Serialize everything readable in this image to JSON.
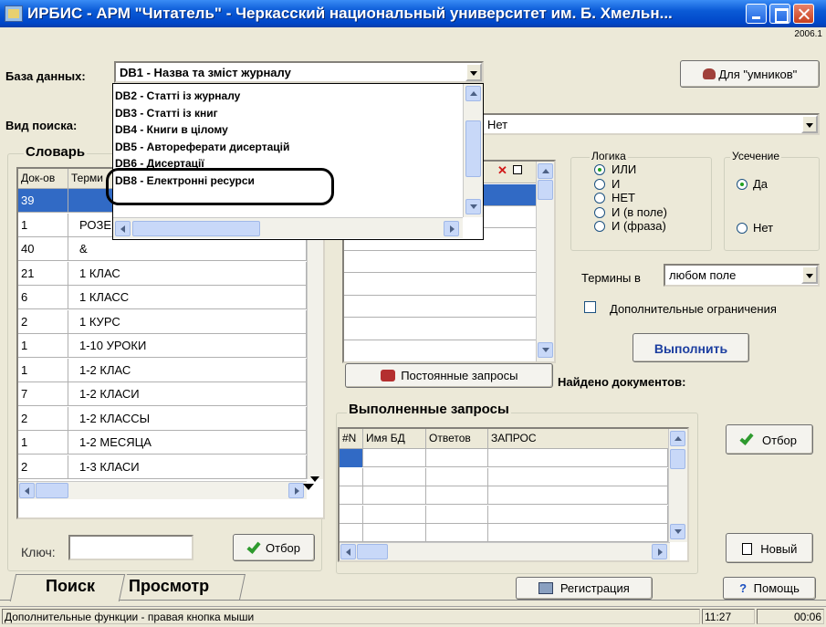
{
  "window": {
    "title": "ИРБИС - АРМ \"Читатель\" - Черкасский национальный университет им. Б. Хмельн...",
    "version": "2006.1"
  },
  "header": {
    "database_label": "База данных:",
    "database_value": "DB1 - Назва та зміст журналу",
    "smart_button": "Для \"умников\"",
    "search_type_label": "Вид поиска:",
    "search_type_value": "Нет"
  },
  "dropdown": {
    "items": [
      "DB2 - Статті із журналу",
      "DB3 - Статті із книг",
      "DB4 - Книги в цілому",
      "DB5 - Автореферати дисертацій",
      "DB6 - Дисертації",
      "DB8 - Електронні ресурси"
    ]
  },
  "dictionary": {
    "title": "Словарь",
    "col_docs": "Док-ов",
    "col_term": "Терми",
    "rows": [
      {
        "docs": "39",
        "term": ""
      },
      {
        "docs": "1",
        "term": "РОЗЕ"
      },
      {
        "docs": "40",
        "term": "&"
      },
      {
        "docs": "21",
        "term": "1 КЛАС"
      },
      {
        "docs": "6",
        "term": "1 КЛАСС"
      },
      {
        "docs": "2",
        "term": "1 КУРС"
      },
      {
        "docs": "1",
        "term": "1-10 УРОКИ"
      },
      {
        "docs": "1",
        "term": "1-2 КЛАС"
      },
      {
        "docs": "7",
        "term": "1-2 КЛАСИ"
      },
      {
        "docs": "2",
        "term": "1-2 КЛАССЫ"
      },
      {
        "docs": "1",
        "term": "1-2 МЕСЯЦА"
      },
      {
        "docs": "2",
        "term": "1-3 КЛАСИ"
      }
    ],
    "key_label": "Ключ:",
    "key_value": "",
    "select_button": "Отбор"
  },
  "query": {
    "permanent_button": "Постоянные запросы",
    "found_label": "Найдено документов:"
  },
  "logic": {
    "title": "Логика",
    "options": [
      "ИЛИ",
      "И",
      "НЕТ",
      "И (в поле)",
      "И (фраза)"
    ],
    "selected": "ИЛИ"
  },
  "truncation": {
    "title": "Усечение",
    "options": [
      "Да",
      "Нет"
    ],
    "selected": "Да"
  },
  "terms_in": {
    "label": "Термины в",
    "value": "любом поле"
  },
  "extra_restrictions": "Дополнительные ограничения",
  "execute_button": "Выполнить",
  "executed": {
    "title": "Выполненные запросы",
    "columns": [
      "#N",
      "Имя БД",
      "Ответов",
      "ЗАПРОС"
    ],
    "select_button": "Отбор",
    "new_button": "Новый"
  },
  "tabs": [
    "Поиск",
    "Просмотр"
  ],
  "registration_button": "Регистрация",
  "help_button": "Помощь",
  "status": {
    "message": "Дополнительные функции - правая кнопка мыши",
    "time": "11:27",
    "elapsed": "00:06"
  },
  "colors": {
    "titlebar": "#0a5ad6",
    "selection": "#316ac5",
    "face": "#ece9d8"
  }
}
